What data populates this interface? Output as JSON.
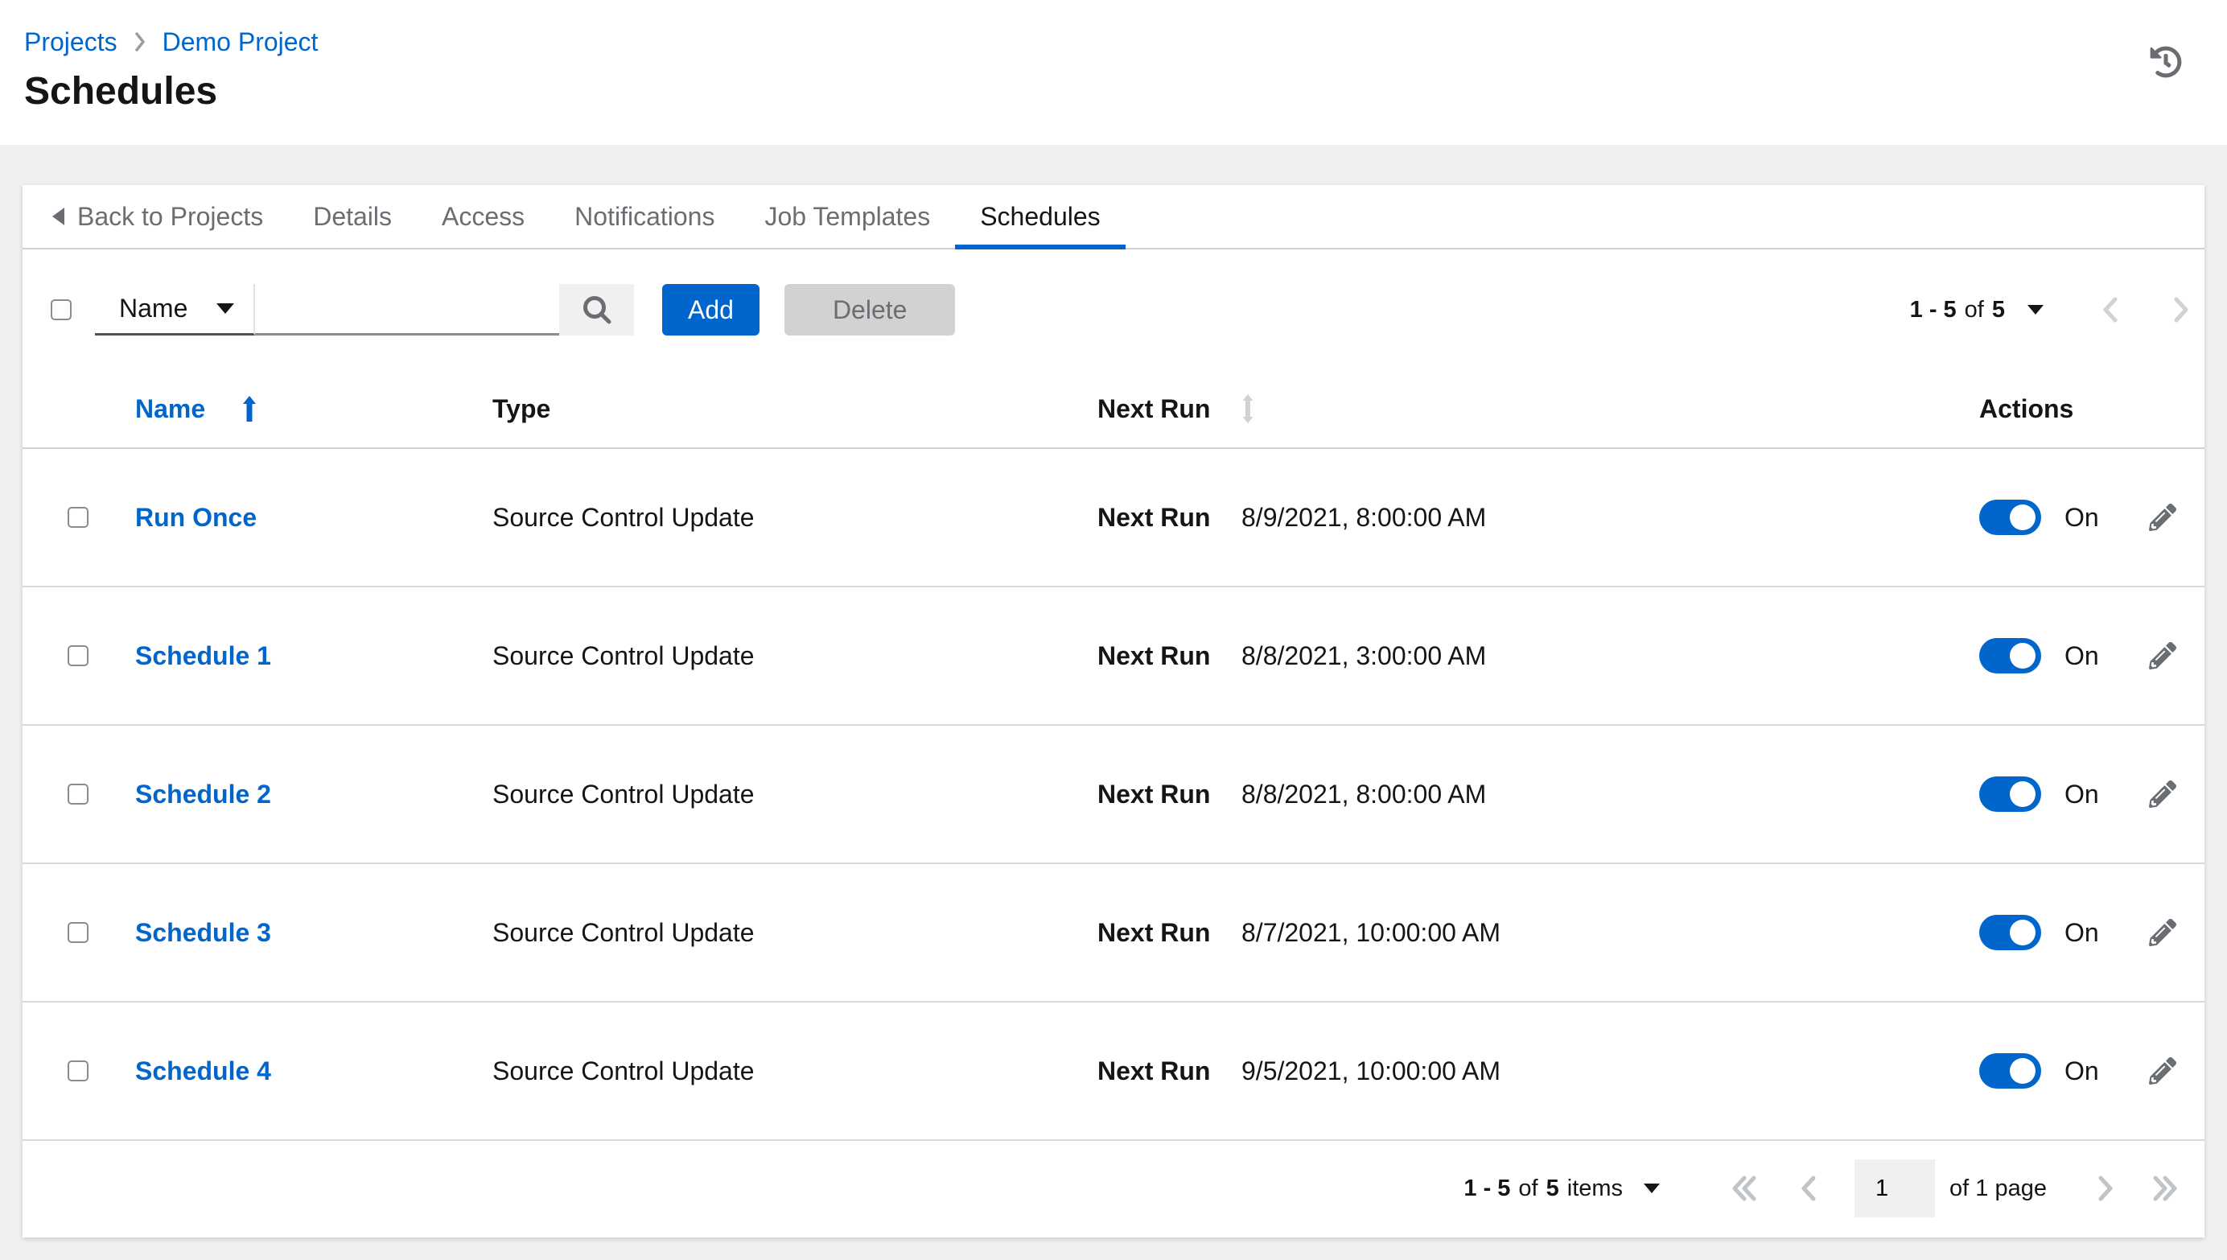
{
  "colors": {
    "accent": "#0066cc",
    "toggle_on": "#0066cc",
    "disabled_bg": "#d2d2d2",
    "secondary_text": "#6a6e73"
  },
  "header": {
    "breadcrumb": [
      {
        "label": "Projects"
      },
      {
        "label": "Demo Project"
      }
    ],
    "title": "Schedules",
    "icons": {
      "history": "history-icon"
    }
  },
  "tabs": [
    {
      "label": "Back to Projects"
    },
    {
      "label": "Details"
    },
    {
      "label": "Access"
    },
    {
      "label": "Notifications"
    },
    {
      "label": "Job Templates"
    },
    {
      "label": "Schedules",
      "active": true
    }
  ],
  "toolbar": {
    "filter_attribute": "Name",
    "search_value": "",
    "icons": {
      "search": "search-icon",
      "select_caret": "chevron-down-icon"
    },
    "add_label": "Add",
    "delete_label": "Delete",
    "pagination": {
      "range": "1 - 5",
      "of_word": "of",
      "total": "5"
    }
  },
  "table": {
    "columns": {
      "name": "Name",
      "type": "Type",
      "next_run": "Next Run",
      "actions": "Actions"
    },
    "sort": {
      "active_column": "Name",
      "direction": "ascending"
    },
    "next_run_label": "Next Run",
    "icons": {
      "sort_asc": "long-arrow-up-icon",
      "sortable": "arrows-up-down-icon",
      "edit": "pencil-icon"
    },
    "rows": [
      {
        "name": "Run Once",
        "type": "Source Control Update",
        "next_run": "8/9/2021, 8:00:00 AM",
        "state": "On"
      },
      {
        "name": "Schedule 1",
        "type": "Source Control Update",
        "next_run": "8/8/2021, 3:00:00 AM",
        "state": "On"
      },
      {
        "name": "Schedule 2",
        "type": "Source Control Update",
        "next_run": "8/8/2021, 8:00:00 AM",
        "state": "On"
      },
      {
        "name": "Schedule 3",
        "type": "Source Control Update",
        "next_run": "8/7/2021, 10:00:00 AM",
        "state": "On"
      },
      {
        "name": "Schedule 4",
        "type": "Source Control Update",
        "next_run": "9/5/2021, 10:00:00 AM",
        "state": "On"
      }
    ]
  },
  "footer_pagination": {
    "range": "1 - 5",
    "of_word": "of",
    "total": "5",
    "items_word": "items",
    "current_page": "1",
    "page_suffix": "of 1 page"
  }
}
